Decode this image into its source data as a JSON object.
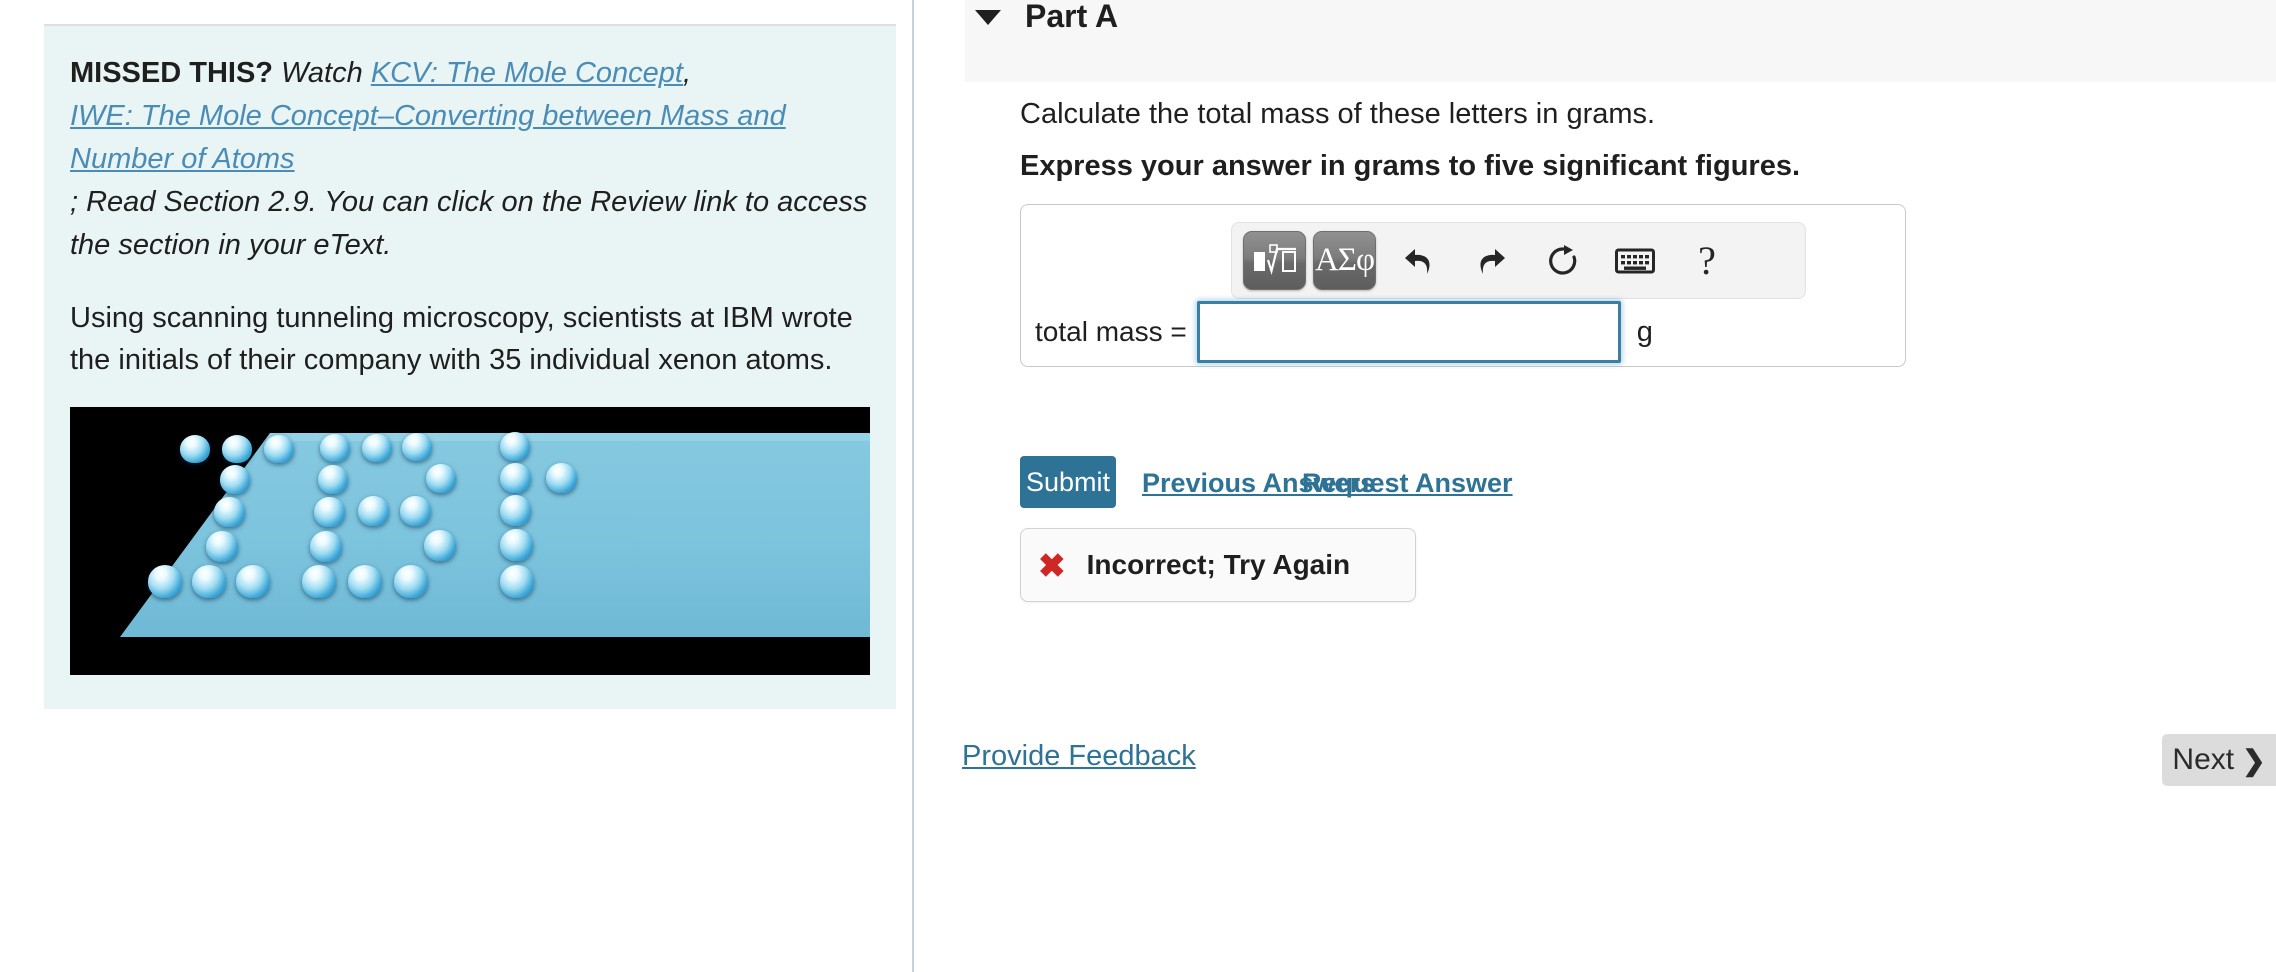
{
  "hint": {
    "missed_label": "MISSED THIS?",
    "watch_word": "Watch",
    "link1": "KCV: The Mole Concept",
    "comma": ",",
    "link2": "IWE: The Mole Concept–Converting between Mass and Number of Atoms",
    "tail": "; Read Section 2.9. You can click on the Review link to access the section in your eText.",
    "body": "Using scanning tunneling microscopy, scientists at IBM wrote the initials of their company with 35 individual xenon atoms.",
    "figure_alt": "stm-xenon-atoms-ibm-image"
  },
  "part": {
    "caret_icon": "caret-down-icon",
    "title": "Part A",
    "question": "Calculate the total mass of these letters in grams.",
    "instruction": "Express your answer in grams to five significant figures."
  },
  "toolbar": {
    "template_button": "math-template-icon",
    "greek_button": "ΑΣφ",
    "undo_icon": "undo-icon",
    "redo_icon": "redo-icon",
    "reset_icon": "reset-icon",
    "keyboard_icon": "keyboard-icon",
    "help_icon": "?"
  },
  "answer": {
    "label": "total mass =",
    "value": "",
    "placeholder": "",
    "unit": "g"
  },
  "actions": {
    "submit": "Submit",
    "previous_answers": "Previous Answers",
    "request_answer": "Request Answer"
  },
  "feedback": {
    "status_icon": "✖",
    "status_text": "Incorrect; Try Again"
  },
  "footer": {
    "provide_feedback": "Provide Feedback",
    "next": "Next",
    "next_chevron": "❯"
  },
  "colors": {
    "hint_bg": "#e9f5f4",
    "link_blue": "#4b8cb6",
    "action_blue": "#2e7296",
    "submit_bg": "#2e7296",
    "error_red": "#cf2626",
    "next_bg": "#dcdcdc",
    "divider": "#c3d3de",
    "header_bg": "#f7f7f7",
    "input_border": "#3a7fa4"
  }
}
